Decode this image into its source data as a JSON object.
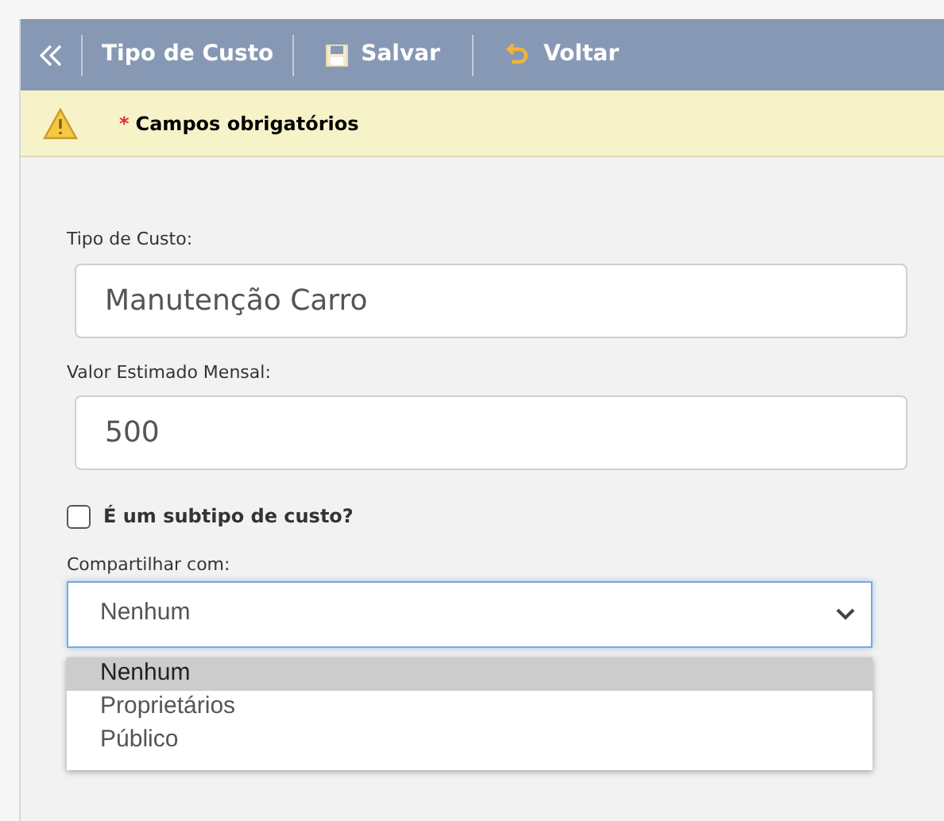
{
  "toolbar": {
    "title": "Tipo de Custo",
    "buttons": [
      {
        "kind": "save",
        "label": "Salvar"
      },
      {
        "kind": "back",
        "label": "Voltar"
      }
    ]
  },
  "notice": {
    "marker": "*",
    "text": "Campos obrigatórios"
  },
  "fields": [
    {
      "label": "Tipo de Custo:",
      "value": "Manutenção Carro"
    },
    {
      "label": "Valor Estimado Mensal:",
      "value": "500"
    }
  ],
  "subtype": {
    "label": "É um subtipo de custo?",
    "checked": false
  },
  "share": {
    "label": "Compartilhar com:",
    "value": "Nenhum",
    "expanded": true,
    "options": [
      {
        "label": "Nenhum",
        "selected": true
      },
      {
        "label": "Proprietários",
        "selected": false
      },
      {
        "label": "Público",
        "selected": false
      }
    ]
  }
}
